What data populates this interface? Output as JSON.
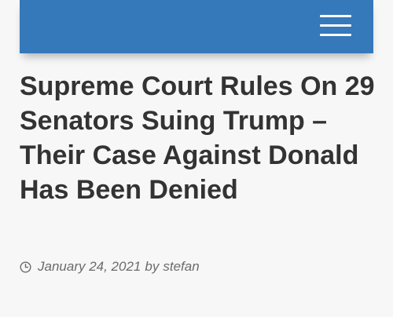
{
  "header": {
    "background_color": "#3579ba",
    "menu_icon": "hamburger-menu-icon"
  },
  "article": {
    "title": "Supreme Court Rules On 29 Senators Suing Trump – Their Case Against Donald Has Been Denied",
    "date": "January 24, 2021",
    "by_label": "by",
    "author": "stefan",
    "date_icon": "clock-icon"
  }
}
